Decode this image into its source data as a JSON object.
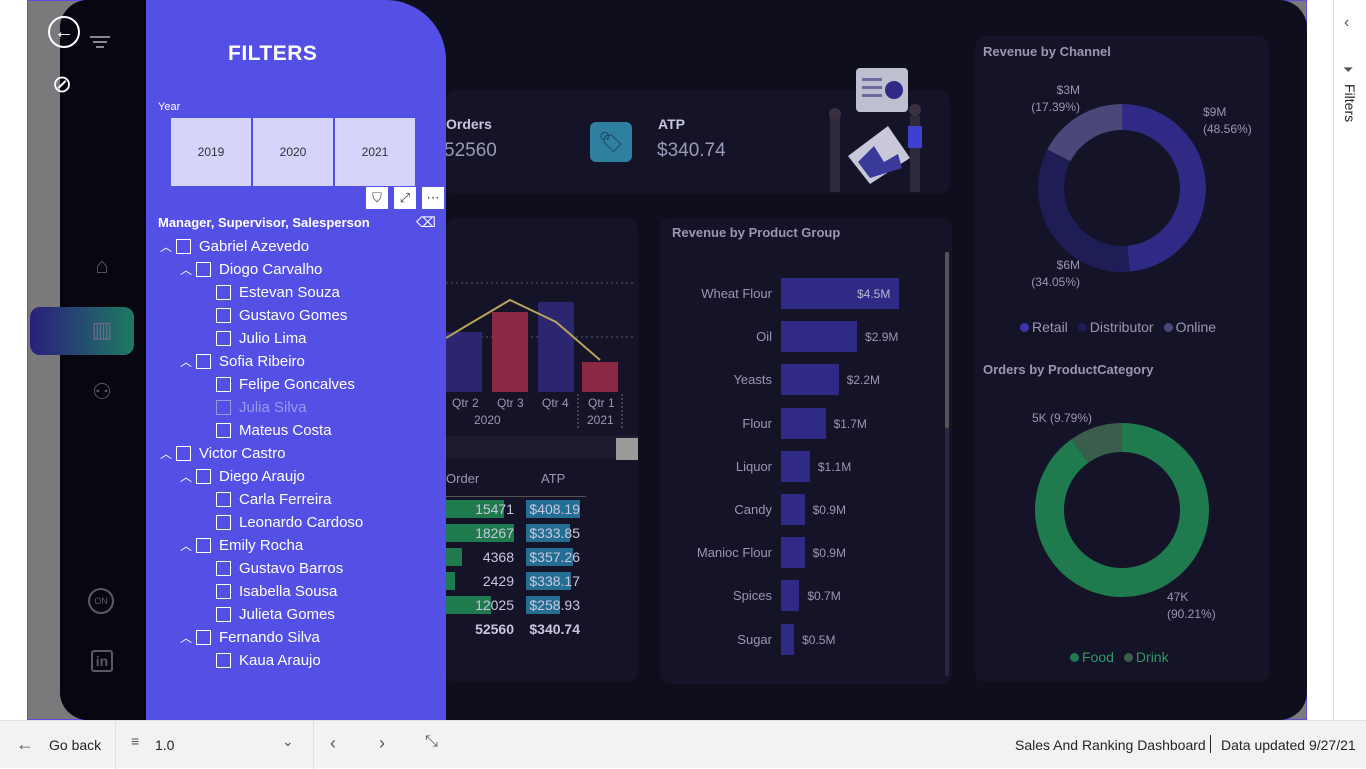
{
  "filters_panel": {
    "title": "FILTERS",
    "year_label": "Year",
    "years": [
      "2019",
      "2020",
      "2021"
    ],
    "hierarchy_label": "Manager, Supervisor, Salesperson",
    "tree": [
      {
        "label": "Gabriel Azevedo",
        "level": 0,
        "expand": true
      },
      {
        "label": "Diogo Carvalho",
        "level": 1,
        "expand": true
      },
      {
        "label": "Estevan Souza",
        "level": 2
      },
      {
        "label": "Gustavo Gomes",
        "level": 2
      },
      {
        "label": "Julio Lima",
        "level": 2
      },
      {
        "label": "Sofia Ribeiro",
        "level": 1,
        "expand": true
      },
      {
        "label": "Felipe Goncalves",
        "level": 2
      },
      {
        "label": "Julia Silva",
        "level": 2,
        "muted": true
      },
      {
        "label": "Mateus Costa",
        "level": 2
      },
      {
        "label": "Victor Castro",
        "level": 0,
        "expand": true
      },
      {
        "label": "Diego Araujo",
        "level": 1,
        "expand": true
      },
      {
        "label": "Carla Ferreira",
        "level": 2
      },
      {
        "label": "Leonardo Cardoso",
        "level": 2
      },
      {
        "label": "Emily Rocha",
        "level": 1,
        "expand": true
      },
      {
        "label": "Gustavo Barros",
        "level": 2
      },
      {
        "label": "Isabella Sousa",
        "level": 2
      },
      {
        "label": "Julieta Gomes",
        "level": 2
      },
      {
        "label": "Fernando Silva",
        "level": 1,
        "expand": true
      },
      {
        "label": "Kaua Araujo",
        "level": 2
      }
    ]
  },
  "kpis": {
    "orders_label": "Orders",
    "orders_value": "52560",
    "atp_label": "ATP",
    "atp_value": "$340.74"
  },
  "quarter_chart": {
    "ticks": [
      "Qtr 2",
      "Qtr 3",
      "Qtr 4",
      "Qtr 1"
    ],
    "years": [
      "2020",
      "2021"
    ]
  },
  "table": {
    "headers": [
      "Order",
      "ATP"
    ],
    "rows": [
      {
        "order": "15471",
        "atp": "$408.19"
      },
      {
        "order": "18267",
        "atp": "$333.85"
      },
      {
        "order": "4368",
        "atp": "$357.26"
      },
      {
        "order": "2429",
        "atp": "$338.17"
      },
      {
        "order": "12025",
        "atp": "$258.93"
      }
    ],
    "total": {
      "order": "52560",
      "atp": "$340.74"
    }
  },
  "chart_data": [
    {
      "type": "bar",
      "title": "Revenue by Product Group",
      "categories": [
        "Wheat Flour",
        "Oil",
        "Yeasts",
        "Flour",
        "Liquor",
        "Candy",
        "Manioc Flour",
        "Spices",
        "Sugar"
      ],
      "values": [
        4.5,
        2.9,
        2.2,
        1.7,
        1.1,
        0.9,
        0.9,
        0.7,
        0.5
      ],
      "labels": [
        "$4.5M",
        "$2.9M",
        "$2.2M",
        "$1.7M",
        "$1.1M",
        "$0.9M",
        "$0.9M",
        "$0.7M",
        "$0.5M"
      ],
      "color": "#2e2a86"
    },
    {
      "type": "pie",
      "title": "Revenue by Channel",
      "categories": [
        "Retail",
        "Distributor",
        "Online"
      ],
      "values": [
        48.56,
        34.05,
        17.39
      ],
      "labels": [
        "$9M\n(48.56%)",
        "$6M\n(34.05%)",
        "$3M\n(17.39%)"
      ],
      "colors": [
        "#2e2a86",
        "#1f1d55",
        "#4a4878"
      ]
    },
    {
      "type": "pie",
      "title": "Orders by ProductCategory",
      "categories": [
        "Food",
        "Drink"
      ],
      "values": [
        90.21,
        9.79
      ],
      "labels": [
        "47K\n(90.21%)",
        "5K (9.79%)"
      ],
      "colors": [
        "#1f7a4e",
        "#3a5d4c"
      ]
    }
  ],
  "bottom_bar": {
    "go_back": "Go back",
    "zoom": "1.0",
    "report_name": "Sales And Ranking Dashboard",
    "updated": "Data updated 9/27/21"
  },
  "right_pane": {
    "label": "Filters"
  }
}
